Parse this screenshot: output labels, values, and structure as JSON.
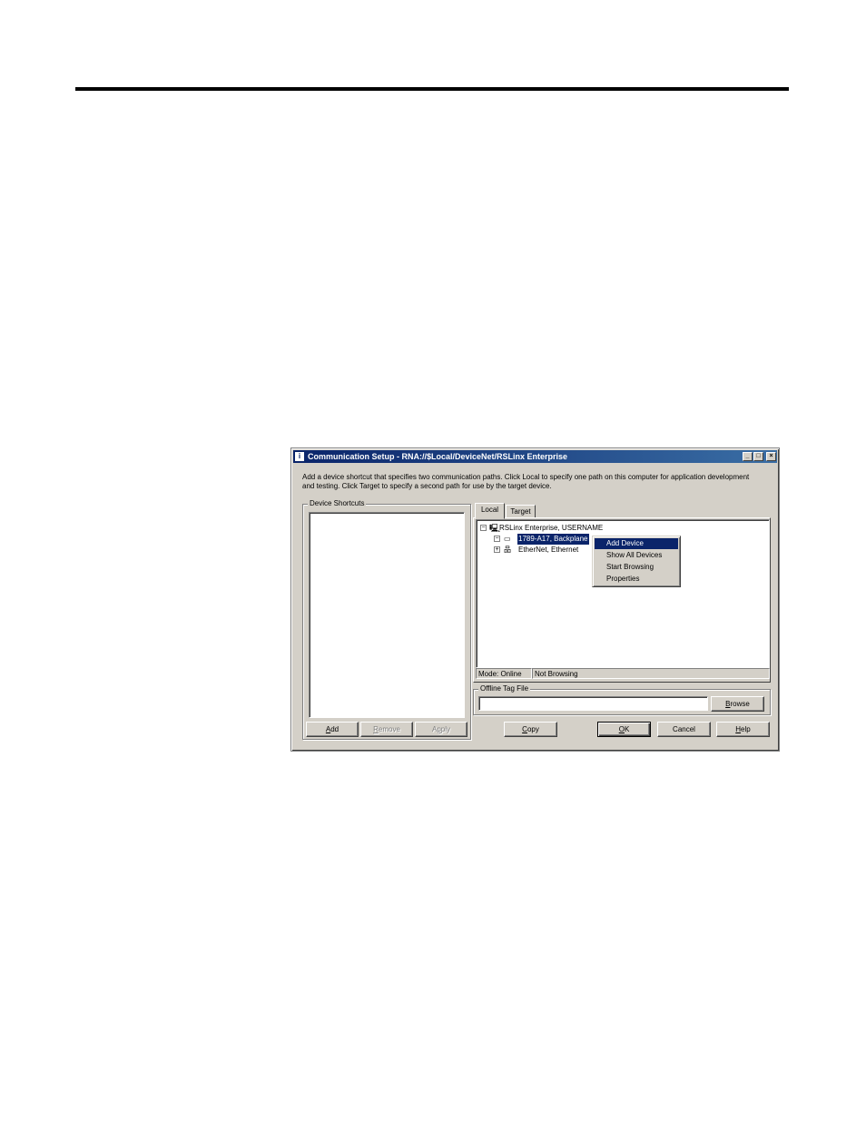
{
  "window": {
    "title": "Communication Setup - RNA://$Local/DeviceNet/RSLinx Enterprise",
    "minimize": "_",
    "maximize": "□",
    "close": "×"
  },
  "intro_text": "Add a device shortcut that specifies two communication paths. Click Local to specify one path on this computer for application development and testing. Click Target to specify a second path for use by the target device.",
  "device_shortcuts": {
    "label": "Device Shortcuts",
    "buttons": {
      "add": "Add",
      "remove": "Remove",
      "apply": "Apply"
    }
  },
  "tabs": [
    {
      "label": "Local",
      "active": true
    },
    {
      "label": "Target",
      "active": false
    }
  ],
  "tree": {
    "root": {
      "label": "RSLinx Enterprise, USERNAME",
      "expander": "−",
      "icon": "computer-icon"
    },
    "children": [
      {
        "label": "1789-A17, Backplane",
        "expander": "−",
        "icon": "backplane-icon",
        "selected": true
      },
      {
        "label": "EtherNet, Ethernet",
        "expander": "+",
        "icon": "network-icon",
        "selected": false
      }
    ]
  },
  "context_menu": {
    "items": [
      {
        "label": "Add Device",
        "highlighted": true
      },
      {
        "label": "Show All Devices",
        "highlighted": false
      },
      {
        "label": "Start Browsing",
        "highlighted": false
      },
      {
        "label": "Properties",
        "highlighted": false
      }
    ]
  },
  "status_bar": {
    "mode": "Mode: Online",
    "browsing": "Not Browsing"
  },
  "offline_tag_file": {
    "label": "Offline Tag File",
    "value": "",
    "browse": "Browse"
  },
  "actions": {
    "copy": "Copy",
    "ok": "OK",
    "cancel": "Cancel",
    "help": "Help"
  },
  "colors": {
    "dialog_bg": "#d4d0c8",
    "titlebar": "#0a246a",
    "selection": "#0a246a"
  }
}
